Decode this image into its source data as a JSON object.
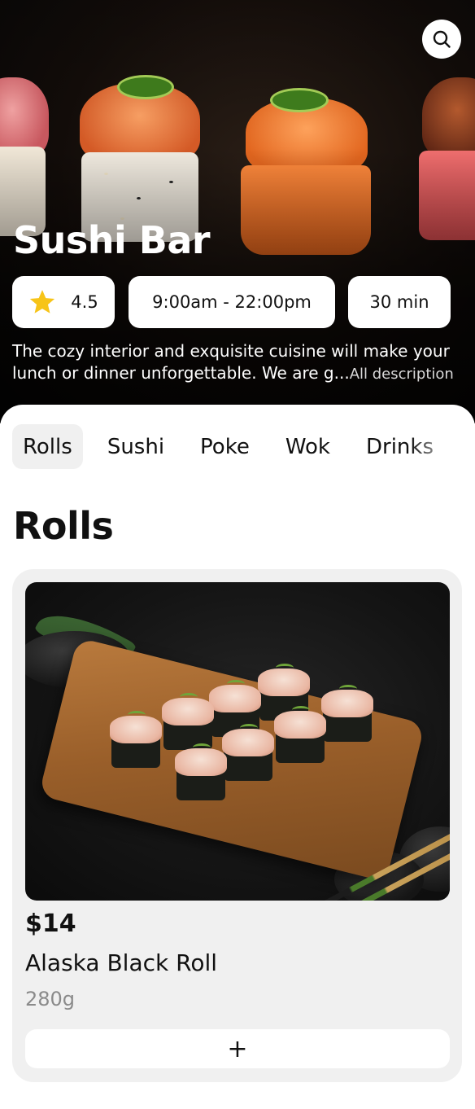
{
  "venue": {
    "title": "Sushi Bar",
    "rating": "4.5",
    "hours": "9:00am - 22:00pm",
    "delivery_time": "30 min",
    "description": "The cozy interior and exquisite cuisine will make your lunch or dinner unforgettable. We are g...",
    "description_more": "All description"
  },
  "header": {
    "search_icon": "search-icon"
  },
  "categories": [
    "Rolls",
    "Sushi",
    "Poke",
    "Wok",
    "Drinks"
  ],
  "active_category": "Rolls",
  "section": {
    "title": "Rolls"
  },
  "products": [
    {
      "price": "$14",
      "name": "Alaska Black Roll",
      "weight": "280g",
      "add_label": "+"
    }
  ],
  "colors": {
    "accent_star": "#F7C418",
    "background": "#FFFFFF",
    "card": "#F0F0F0",
    "muted_text": "#8A8A8A"
  }
}
